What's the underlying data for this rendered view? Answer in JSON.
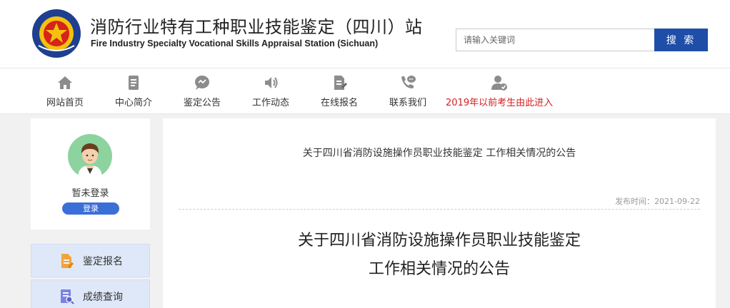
{
  "header": {
    "title_cn": "消防行业特有工种职业技能鉴定（四川）站",
    "title_en": "Fire Industry Specialty Vocational Skills Appraisal Station (Sichuan)",
    "logo_name": "china-fire-and-rescue-emblem"
  },
  "search": {
    "placeholder": "请输入关键词",
    "button_label": "搜 索"
  },
  "nav": {
    "items": [
      {
        "label": "网站首页",
        "icon": "home-icon"
      },
      {
        "label": "中心简介",
        "icon": "document-icon"
      },
      {
        "label": "鉴定公告",
        "icon": "chat-bubble-icon"
      },
      {
        "label": "工作动态",
        "icon": "speaker-icon"
      },
      {
        "label": "在线报名",
        "icon": "form-edit-icon"
      },
      {
        "label": "联系我们",
        "icon": "phone-chat-icon"
      },
      {
        "label": "2019年以前考生由此进入",
        "icon": "user-check-icon"
      }
    ]
  },
  "user": {
    "status": "暂未登录",
    "login_label": "登录"
  },
  "sidebar": {
    "items": [
      {
        "label": "鉴定报名",
        "icon": "register-file-icon"
      },
      {
        "label": "成绩查询",
        "icon": "score-query-icon"
      }
    ]
  },
  "article": {
    "breadcrumb_title": "关于四川省消防设施操作员职业技能鉴定 工作相关情况的公告",
    "publish_label": "发布时间：",
    "publish_date": "2021-09-22",
    "title_line1": "关于四川省消防设施操作员职业技能鉴定",
    "title_line2": "工作相关情况的公告"
  },
  "colors": {
    "accent": "#1f4ea8",
    "alert_red": "#d21f1f",
    "sidebar_bg": "#dfe8f8"
  }
}
